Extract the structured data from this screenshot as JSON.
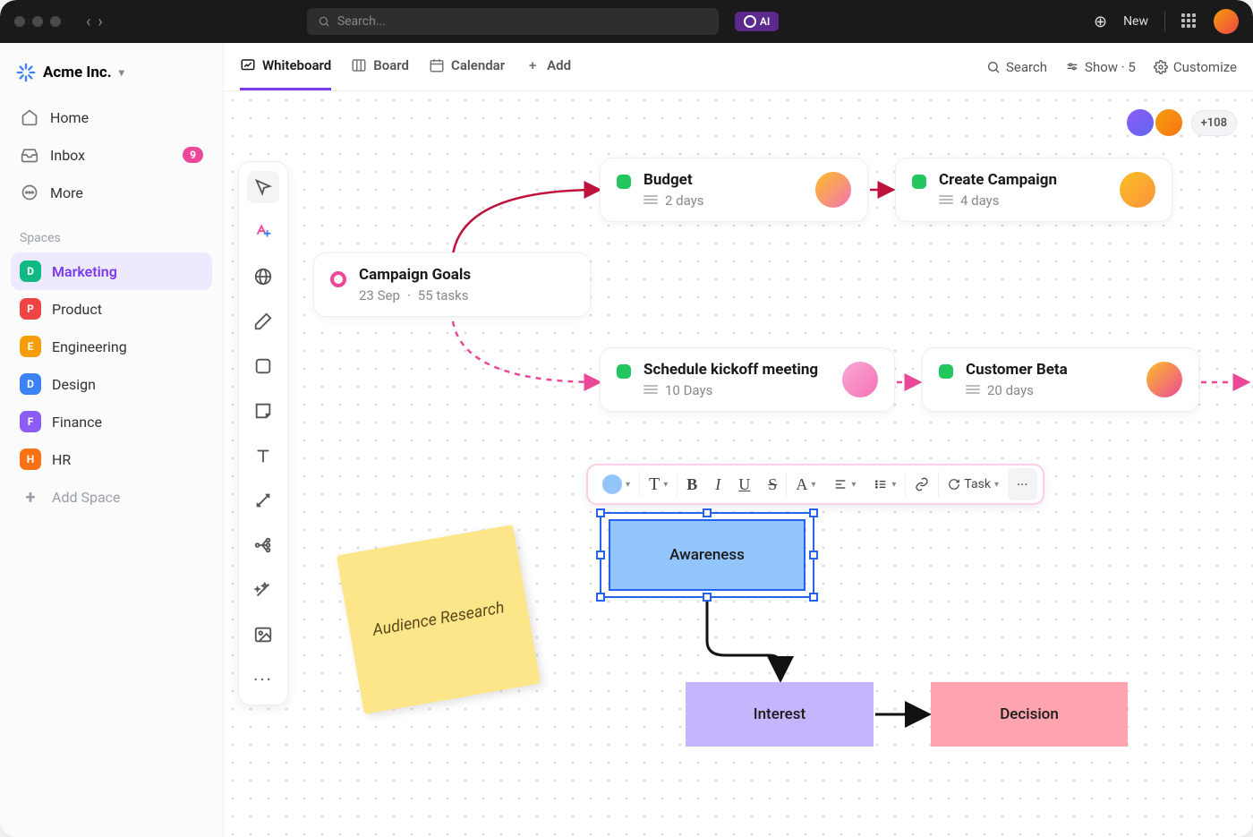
{
  "titlebar": {
    "search_placeholder": "Search...",
    "ai_label": "AI",
    "new_label": "New"
  },
  "workspace": {
    "name": "Acme Inc."
  },
  "nav": {
    "home": "Home",
    "inbox": "Inbox",
    "inbox_badge": "9",
    "more": "More"
  },
  "spaces_label": "Spaces",
  "spaces": [
    {
      "letter": "D",
      "name": "Marketing",
      "color": "#10b981"
    },
    {
      "letter": "P",
      "name": "Product",
      "color": "#ef4444"
    },
    {
      "letter": "E",
      "name": "Engineering",
      "color": "#f59e0b"
    },
    {
      "letter": "D",
      "name": "Design",
      "color": "#3b82f6"
    },
    {
      "letter": "F",
      "name": "Finance",
      "color": "#8b5cf6"
    },
    {
      "letter": "H",
      "name": "HR",
      "color": "#f97316"
    }
  ],
  "add_space": "Add Space",
  "tabs": {
    "whiteboard": "Whiteboard",
    "board": "Board",
    "calendar": "Calendar",
    "add": "Add",
    "search": "Search",
    "show": "Show · 5",
    "customize": "Customize"
  },
  "collab_more": "+108",
  "cards": {
    "goals": {
      "title": "Campaign Goals",
      "date": "23 Sep",
      "tasks": "55 tasks"
    },
    "budget": {
      "title": "Budget",
      "meta": "2 days"
    },
    "create": {
      "title": "Create Campaign",
      "meta": "4 days"
    },
    "kickoff": {
      "title": "Schedule kickoff meeting",
      "meta": "10 Days"
    },
    "beta": {
      "title": "Customer Beta",
      "meta": "20 days"
    }
  },
  "sticky": "Audience Research",
  "shapes": {
    "awareness": "Awareness",
    "interest": "Interest",
    "decision": "Decision"
  },
  "text_toolbar": {
    "task": "Task"
  }
}
